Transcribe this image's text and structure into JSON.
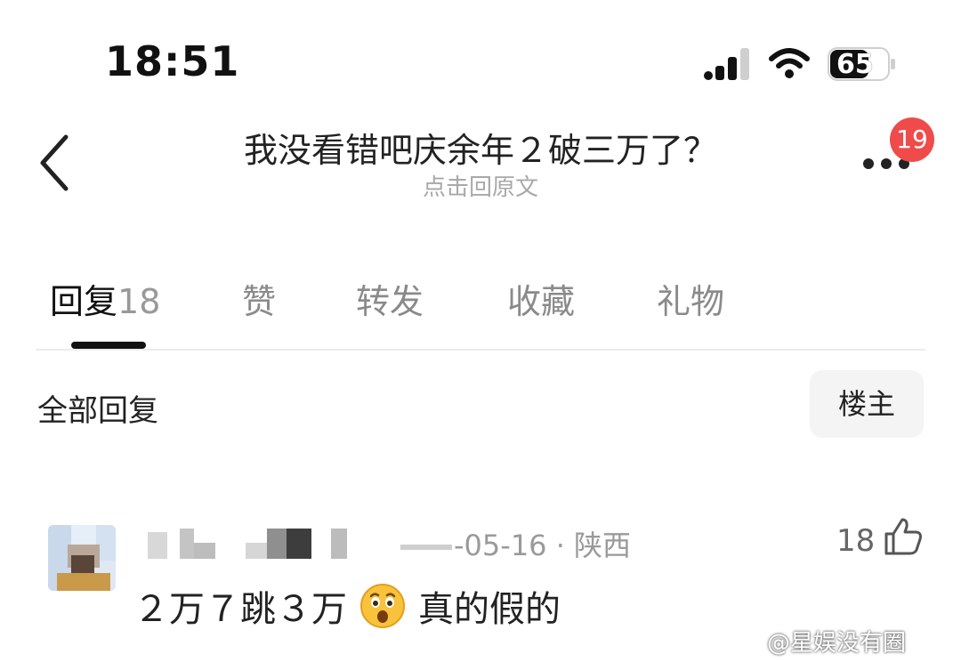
{
  "status_bar": {
    "time": "18:51",
    "battery": "65"
  },
  "header": {
    "title": "我没看错吧庆余年２破三万了？",
    "subtitle": "点击回原文",
    "badge_count": "19"
  },
  "tabs": [
    {
      "label": "回复",
      "count": "18"
    },
    {
      "label": "赞"
    },
    {
      "label": "转发"
    },
    {
      "label": "收藏"
    },
    {
      "label": "礼物"
    }
  ],
  "filter": {
    "all_label": "全部回复",
    "op_label": "楼主"
  },
  "replies": [
    {
      "meta": "-05-16 · 陕西",
      "likes": "18",
      "text": "２万７跳３万",
      "text_tail": "真的假的"
    }
  ],
  "watermark": "@星娱没有圈",
  "colors": {
    "badge": "#ef4b4b",
    "muted": "#9a9a9a"
  }
}
